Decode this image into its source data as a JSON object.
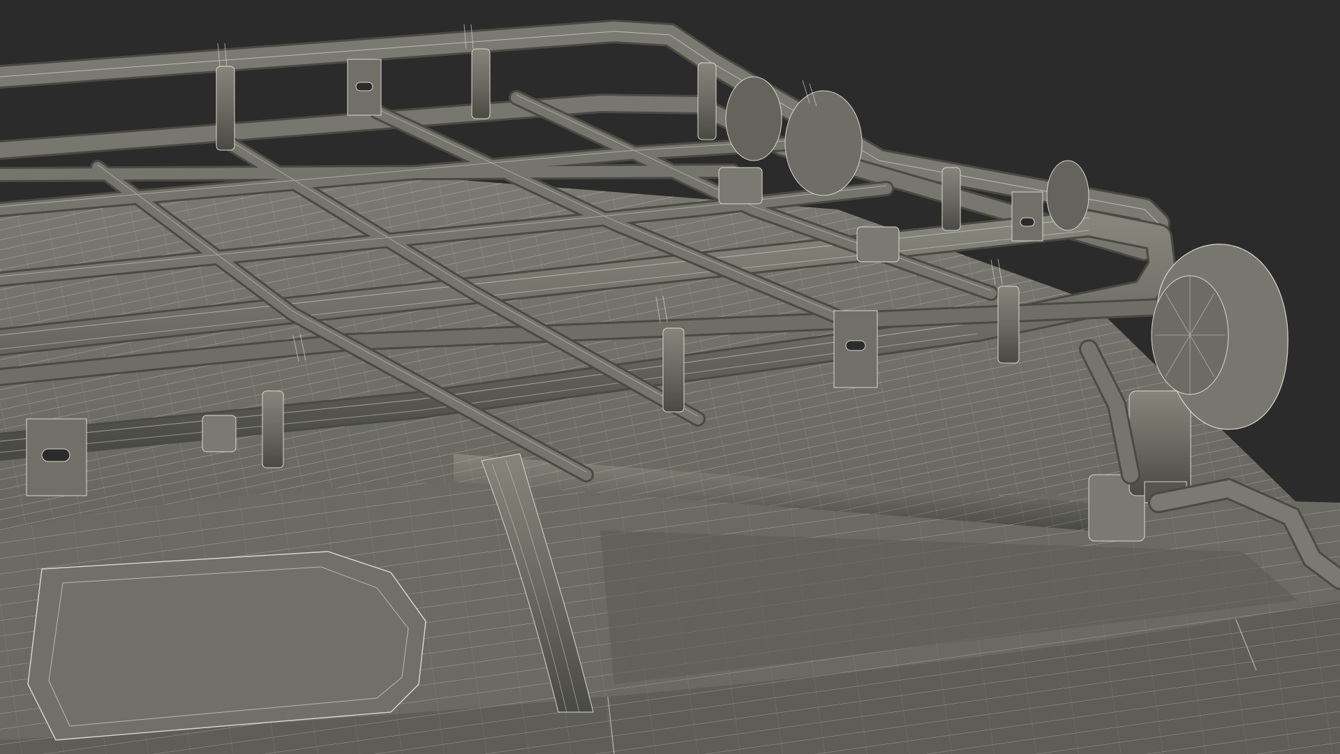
{
  "scene": {
    "subject": "roof-rack-wireframe-render",
    "colors": {
      "background": "#2b2b2b",
      "surface": "#6c6c64",
      "surface_dark": "#55554e",
      "surface_light": "#7a7a72",
      "tube": "#6a6a62",
      "tube_shadow": "#4a4a44",
      "wire": "#d9d9d2"
    }
  }
}
